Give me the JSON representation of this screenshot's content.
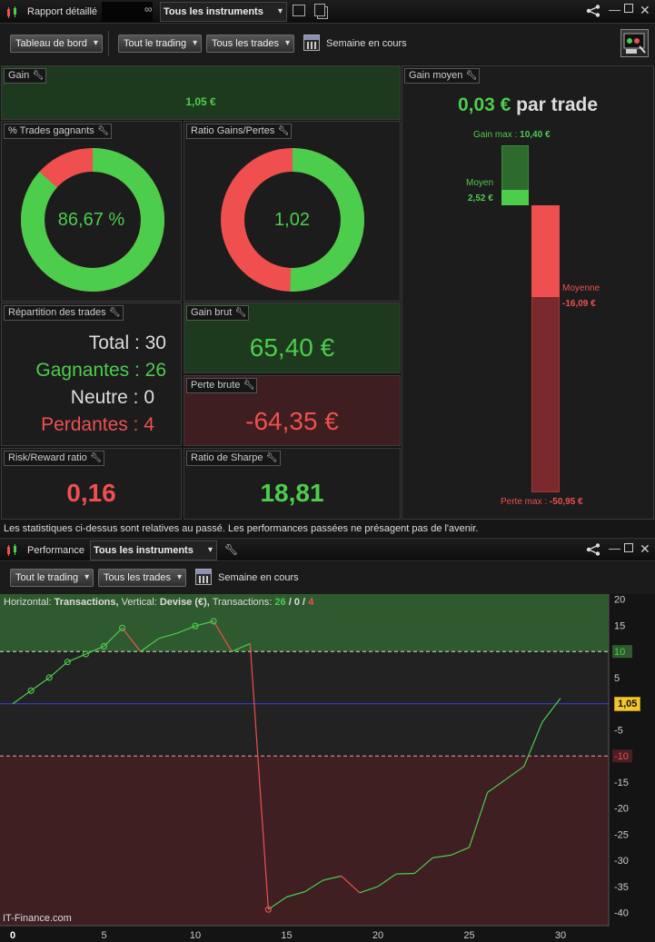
{
  "top_window": {
    "title": "Rapport détaillé",
    "instrument_tab": "Tous les instruments",
    "toolbar": {
      "dashboard": "Tableau de bord",
      "trading": "Tout le trading",
      "trades": "Tous les trades",
      "period": "Semaine en cours"
    }
  },
  "panels": {
    "gain": {
      "title": "Gain",
      "value": "1,05 €"
    },
    "win_rate": {
      "title": "% Trades gagnants",
      "value": "86,67 %",
      "fraction": 0.8667
    },
    "gain_loss_ratio": {
      "title": "Ratio Gains/Pertes",
      "value": "1,02",
      "fraction": 0.505
    },
    "avg_gain": {
      "title": "Gain moyen",
      "value": "0,03 €",
      "unit": "par trade",
      "max_gain_label": "Gain max :",
      "max_gain": "10,40 €",
      "avg_label": "Moyen",
      "avg_value": "2,52 €",
      "avg_loss_label": "Moyenne",
      "avg_loss_value": "-16,09 €",
      "max_loss_label": "Perte max :",
      "max_loss": "-50,95 €"
    },
    "distribution": {
      "title": "Répartition des trades",
      "total": "Total : 30",
      "winners": "Gagnantes : 26",
      "neutral": "Neutre : 0",
      "losers": "Perdantes : 4"
    },
    "gross_gain": {
      "title": "Gain brut",
      "value": "65,40 €"
    },
    "gross_loss": {
      "title": "Perte brute",
      "value": "-64,35 €"
    },
    "risk_reward": {
      "title": "Risk/Reward ratio",
      "value": "0,16"
    },
    "sharpe": {
      "title": "Ratio de Sharpe",
      "value": "18,81"
    }
  },
  "disclaimer": "Les statistiques ci-dessus sont relatives au passé. Les performances passées ne présagent pas de l'avenir.",
  "bottom_window": {
    "title": "Performance",
    "instrument_tab": "Tous les instruments",
    "toolbar": {
      "trading": "Tout le trading",
      "trades": "Tous les trades",
      "period": "Semaine en cours"
    },
    "legend": {
      "h_label": "Horizontal:",
      "h_value": "Transactions,",
      "v_label": "Vertical:",
      "v_value": "Devise (€),",
      "t_label": "Transactions:",
      "t_win": "26",
      "t_sep1": " / ",
      "t_neutral": "0",
      "t_sep2": " / ",
      "t_loss": "4"
    },
    "watermark": "IT-Finance.com",
    "current_value": "1,05"
  },
  "colors": {
    "green": "#4ccd4c",
    "red": "#ef4f4f",
    "blue_line": "#3a3ad0"
  },
  "chart_data": {
    "type": "line",
    "x": [
      0,
      1,
      2,
      3,
      4,
      5,
      6,
      7,
      8,
      9,
      10,
      11,
      12,
      13,
      14,
      15,
      16,
      17,
      18,
      19,
      20,
      21,
      22,
      23,
      24,
      25,
      26,
      27,
      28,
      29,
      30
    ],
    "y": [
      0,
      2.5,
      5,
      8,
      9.5,
      11,
      14.5,
      10,
      12.5,
      13.5,
      14.9,
      15.8,
      10,
      11.5,
      -39.4,
      -37,
      -36,
      -33.8,
      -33,
      -36.2,
      -35,
      -32.6,
      -32.5,
      -29.5,
      -29,
      -27.5,
      -17,
      -14.5,
      -12,
      -3.5,
      1.05
    ],
    "xlim": [
      0,
      32.5
    ],
    "ylim": [
      -42.5,
      21
    ],
    "x_ticks": [
      0,
      5,
      10,
      15,
      20,
      25,
      30
    ],
    "y_ticks": [
      20,
      15,
      10,
      5,
      0,
      -5,
      -10,
      -15,
      -20,
      -25,
      -30,
      -35,
      -40
    ],
    "thresholds": {
      "upper": 10,
      "lower": -10,
      "zero": 0
    },
    "marker_points": [
      1,
      2,
      3,
      4,
      5,
      6,
      10,
      11,
      14
    ],
    "grid": false
  }
}
